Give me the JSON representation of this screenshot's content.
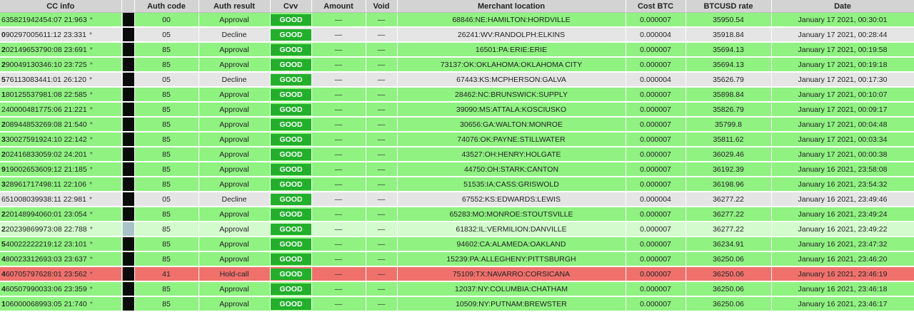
{
  "headers": {
    "cc_info": "CC info",
    "auth_code": "Auth code",
    "auth_result": "Auth result",
    "cvv": "Cvv",
    "amount": "Amount",
    "void": "Void",
    "merchant_location": "Merchant location",
    "cost_btc": "Cost BTC",
    "btcusd_rate": "BTCUSD rate",
    "date": "Date"
  },
  "colors": {
    "approval_row": "#8ff281",
    "decline_row": "#e5e5e5",
    "hold_row": "#f0716c",
    "highlight_row": "#d3fbcd",
    "cvv_badge": "#22b02b",
    "header": "#d3d3d3"
  },
  "rows": [
    {
      "cc_prefix": "",
      "cc_rest": "635821942454:07 21:963",
      "star": "*",
      "auth_code": "00",
      "auth_result": "Approval",
      "cvv": "GOOD",
      "amount": "—",
      "void": "—",
      "merchant": "68846:NE:HAMILTON:HORDVILLE",
      "cost_btc": "0.000007",
      "btcusd": "35950.54",
      "date": "January 17 2021, 00:30:01",
      "status": "approval"
    },
    {
      "cc_prefix": "0",
      "cc_rest": "90297005611:12 23:331",
      "star": "*",
      "auth_code": "05",
      "auth_result": "Decline",
      "cvv": "GOOD",
      "amount": "—",
      "void": "—",
      "merchant": "26241:WV:RANDOLPH:ELKINS",
      "cost_btc": "0.000004",
      "btcusd": "35918.84",
      "date": "January 17 2021, 00:28:44",
      "status": "decline"
    },
    {
      "cc_prefix": "2",
      "cc_rest": "02149653790:08 23:691",
      "star": "*",
      "auth_code": "85",
      "auth_result": "Approval",
      "cvv": "GOOD",
      "amount": "—",
      "void": "—",
      "merchant": "16501:PA:ERIE:ERIE",
      "cost_btc": "0.000007",
      "btcusd": "35694.13",
      "date": "January 17 2021, 00:19:58",
      "status": "approval"
    },
    {
      "cc_prefix": "2",
      "cc_rest": "90049130346:10 23:725",
      "star": "*",
      "auth_code": "85",
      "auth_result": "Approval",
      "cvv": "GOOD",
      "amount": "—",
      "void": "—",
      "merchant": "73137:OK:OKLAHOMA:OKLAHOMA CITY",
      "cost_btc": "0.000007",
      "btcusd": "35694.13",
      "date": "January 17 2021, 00:19:18",
      "status": "approval"
    },
    {
      "cc_prefix": "5",
      "cc_rest": "76113083441:01 26:120",
      "star": "*",
      "auth_code": "05",
      "auth_result": "Decline",
      "cvv": "GOOD",
      "amount": "—",
      "void": "—",
      "merchant": "67443:KS:MCPHERSON:GALVA",
      "cost_btc": "0.000004",
      "btcusd": "35626.79",
      "date": "January 17 2021, 00:17:30",
      "status": "decline"
    },
    {
      "cc_prefix": "1",
      "cc_rest": "80125537981:08 22:585",
      "star": "*",
      "auth_code": "85",
      "auth_result": "Approval",
      "cvv": "GOOD",
      "amount": "—",
      "void": "—",
      "merchant": "28462:NC:BRUNSWICK:SUPPLY",
      "cost_btc": "0.000007",
      "btcusd": "35898.84",
      "date": "January 17 2021, 00:10:07",
      "status": "approval"
    },
    {
      "cc_prefix": "",
      "cc_rest": "240000481775:06 21:221",
      "star": "*",
      "auth_code": "85",
      "auth_result": "Approval",
      "cvv": "GOOD",
      "amount": "—",
      "void": "—",
      "merchant": "39090:MS:ATTALA:KOSCIUSKO",
      "cost_btc": "0.000007",
      "btcusd": "35826.79",
      "date": "January 17 2021, 00:09:17",
      "status": "approval"
    },
    {
      "cc_prefix": "2",
      "cc_rest": "08944853269:08 21:540",
      "star": "*",
      "auth_code": "85",
      "auth_result": "Approval",
      "cvv": "GOOD",
      "amount": "—",
      "void": "—",
      "merchant": "30656:GA:WALTON:MONROE",
      "cost_btc": "0.000007",
      "btcusd": "35799.8",
      "date": "January 17 2021, 00:04:48",
      "status": "approval"
    },
    {
      "cc_prefix": "3",
      "cc_rest": "30027591924:10 22:142",
      "star": "*",
      "auth_code": "85",
      "auth_result": "Approval",
      "cvv": "GOOD",
      "amount": "—",
      "void": "—",
      "merchant": "74076:OK:PAYNE:STILLWATER",
      "cost_btc": "0.000007",
      "btcusd": "35811.62",
      "date": "January 17 2021, 00:03:34",
      "status": "approval"
    },
    {
      "cc_prefix": "2",
      "cc_rest": "02416833059:02 24:201",
      "star": "*",
      "auth_code": "85",
      "auth_result": "Approval",
      "cvv": "GOOD",
      "amount": "—",
      "void": "—",
      "merchant": "43527:OH:HENRY:HOLGATE",
      "cost_btc": "0.000007",
      "btcusd": "36029.46",
      "date": "January 17 2021, 00:00:38",
      "status": "approval"
    },
    {
      "cc_prefix": "9",
      "cc_rest": "19002653609:12 21:185",
      "star": "*",
      "auth_code": "85",
      "auth_result": "Approval",
      "cvv": "GOOD",
      "amount": "—",
      "void": "—",
      "merchant": "44750:OH:STARK:CANTON",
      "cost_btc": "0.000007",
      "btcusd": "36192.39",
      "date": "January 16 2021, 23:58:08",
      "status": "approval"
    },
    {
      "cc_prefix": "3",
      "cc_rest": "28961717498:11 22:106",
      "star": "*",
      "auth_code": "85",
      "auth_result": "Approval",
      "cvv": "GOOD",
      "amount": "—",
      "void": "—",
      "merchant": "51535:IA:CASS:GRISWOLD",
      "cost_btc": "0.000007",
      "btcusd": "36198.96",
      "date": "January 16 2021, 23:54:32",
      "status": "approval"
    },
    {
      "cc_prefix": "",
      "cc_rest": "651008039938:11 22:981",
      "star": "*",
      "auth_code": "05",
      "auth_result": "Decline",
      "cvv": "GOOD",
      "amount": "—",
      "void": "—",
      "merchant": "67552:KS:EDWARDS:LEWIS",
      "cost_btc": "0.000004",
      "btcusd": "36277.22",
      "date": "January 16 2021, 23:49:46",
      "status": "decline"
    },
    {
      "cc_prefix": "2",
      "cc_rest": "20148994060:01 23:054",
      "star": "*",
      "auth_code": "85",
      "auth_result": "Approval",
      "cvv": "GOOD",
      "amount": "—",
      "void": "—",
      "merchant": "65283:MO:MONROE:STOUTSVILLE",
      "cost_btc": "0.000007",
      "btcusd": "36277.22",
      "date": "January 16 2021, 23:49:24",
      "status": "approval"
    },
    {
      "cc_prefix": "2",
      "cc_rest": "20239869973:08 22:788",
      "star": "*",
      "auth_code": "85",
      "auth_result": "Approval",
      "cvv": "GOOD",
      "amount": "—",
      "void": "—",
      "merchant": "61832:IL:VERMILION:DANVILLE",
      "cost_btc": "0.000007",
      "btcusd": "36277.22",
      "date": "January 16 2021, 23:49:22",
      "status": "highlight"
    },
    {
      "cc_prefix": "5",
      "cc_rest": "40022222219:12 23:101",
      "star": "*",
      "auth_code": "85",
      "auth_result": "Approval",
      "cvv": "GOOD",
      "amount": "—",
      "void": "—",
      "merchant": "94602:CA:ALAMEDA:OAKLAND",
      "cost_btc": "0.000007",
      "btcusd": "36234.91",
      "date": "January 16 2021, 23:47:32",
      "status": "approval"
    },
    {
      "cc_prefix": "4",
      "cc_rest": "80023312693:03 23:637",
      "star": "*",
      "auth_code": "85",
      "auth_result": "Approval",
      "cvv": "GOOD",
      "amount": "—",
      "void": "—",
      "merchant": "15239:PA:ALLEGHENY:PITTSBURGH",
      "cost_btc": "0.000007",
      "btcusd": "36250.06",
      "date": "January 16 2021, 23:46:20",
      "status": "approval"
    },
    {
      "cc_prefix": "4",
      "cc_rest": "60705797628:01 23:562",
      "star": "*",
      "auth_code": "41",
      "auth_result": "Hold-call",
      "cvv": "GOOD",
      "amount": "—",
      "void": "—",
      "merchant": "75109:TX:NAVARRO:CORSICANA",
      "cost_btc": "0.000007",
      "btcusd": "36250.06",
      "date": "January 16 2021, 23:46:19",
      "status": "hold"
    },
    {
      "cc_prefix": "4",
      "cc_rest": "60507990033:06 23:359",
      "star": "*",
      "auth_code": "85",
      "auth_result": "Approval",
      "cvv": "GOOD",
      "amount": "—",
      "void": "—",
      "merchant": "12037:NY:COLUMBIA:CHATHAM",
      "cost_btc": "0.000007",
      "btcusd": "36250.06",
      "date": "January 16 2021, 23:46:18",
      "status": "approval"
    },
    {
      "cc_prefix": "1",
      "cc_rest": "06000068993:05 21:740",
      "star": "*",
      "auth_code": "85",
      "auth_result": "Approval",
      "cvv": "GOOD",
      "amount": "—",
      "void": "—",
      "merchant": "10509:NY:PUTNAM:BREWSTER",
      "cost_btc": "0.000007",
      "btcusd": "36250.06",
      "date": "January 16 2021, 23:46:17",
      "status": "approval"
    }
  ]
}
